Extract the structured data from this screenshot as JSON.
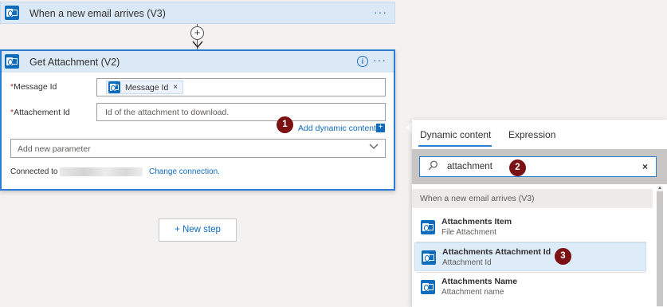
{
  "trigger": {
    "title": "When a new email arrives (V3)",
    "more": "···"
  },
  "connector": {
    "plus": "+",
    "arrow": "⌄"
  },
  "action": {
    "title": "Get Attachment (V2)",
    "info": "i",
    "more": "···",
    "message_id": {
      "required": "*",
      "label": "Message Id",
      "token": "Message Id",
      "token_remove": "×"
    },
    "attachment_id": {
      "required": "*",
      "label": "Attachement Id",
      "placeholder": "Id of the attachment to download."
    },
    "add_dynamic": "Add dynamic content",
    "add_dynamic_plus": "+",
    "add_param_placeholder": "Add new parameter",
    "connected_to": "Connected to",
    "change_connection": "Change connection."
  },
  "badges": [
    "1",
    "2",
    "3"
  ],
  "new_step": "+ New step",
  "dynamic_panel": {
    "tabs": [
      "Dynamic content",
      "Expression"
    ],
    "search_value": "attachment",
    "clear": "×",
    "group_header": "When a new email arrives (V3)",
    "items": [
      {
        "name": "Attachments Item",
        "desc": "File Attachment"
      },
      {
        "name": "Attachments Attachment Id",
        "desc": "Attachment Id"
      },
      {
        "name": "Attachments Name",
        "desc": "Attachment name"
      }
    ]
  },
  "colors": {
    "accent": "#2b7cd3",
    "link": "#0f6cbd",
    "badge": "#7b1113",
    "header": "#dbe8f6"
  }
}
